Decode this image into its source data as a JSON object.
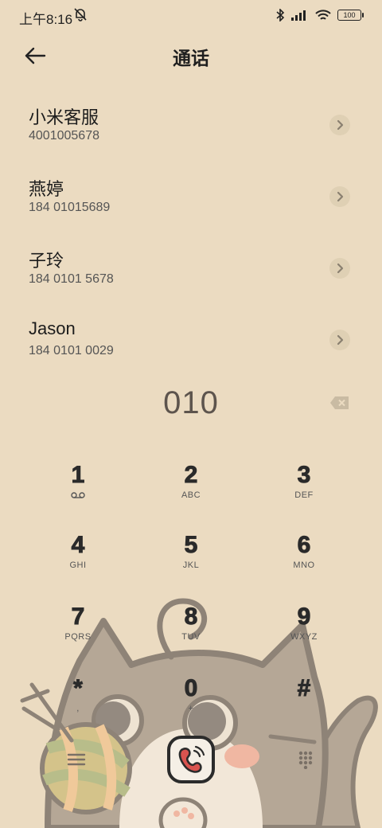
{
  "status": {
    "time": "上午8:16",
    "battery": "100"
  },
  "header": {
    "title": "通话"
  },
  "contacts": [
    {
      "name": "小米客服",
      "number": "4001005678"
    },
    {
      "name": "燕婷",
      "number": "184 01015689"
    },
    {
      "name": "子玲",
      "number": "184 0101 5678"
    },
    {
      "name": "Jason",
      "number": "184 0101 0029"
    }
  ],
  "dialer": {
    "input": "010"
  },
  "keys": [
    {
      "digit": "1",
      "letters": ""
    },
    {
      "digit": "2",
      "letters": "ABC"
    },
    {
      "digit": "3",
      "letters": "DEF"
    },
    {
      "digit": "4",
      "letters": "GHI"
    },
    {
      "digit": "5",
      "letters": "JKL"
    },
    {
      "digit": "6",
      "letters": "MNO"
    },
    {
      "digit": "7",
      "letters": "PQRS"
    },
    {
      "digit": "8",
      "letters": "TUV"
    },
    {
      "digit": "9",
      "letters": "WXYZ"
    },
    {
      "digit": "*",
      "letters": ","
    },
    {
      "digit": "0",
      "letters": "+"
    },
    {
      "digit": "#",
      "letters": ""
    }
  ],
  "icons": {
    "back": "arrow-left-icon",
    "chevron": "chevron-right-icon",
    "backspace": "backspace-icon",
    "voicemail": "voicemail-icon",
    "call": "phone-icon",
    "menu": "menu-icon",
    "dialpad": "dialpad-icon"
  },
  "colors": {
    "background": "#ebdbc1",
    "accent_call": "#d9534f",
    "cat": "#b5a796"
  }
}
